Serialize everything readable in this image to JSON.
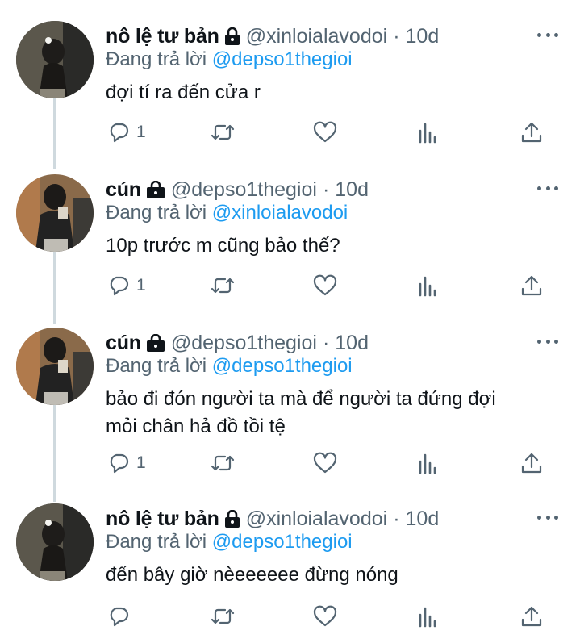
{
  "tweets": [
    {
      "author_name": "nô lệ tư bản",
      "handle": "@xinloialavodoi",
      "separator": "·",
      "time": "10d",
      "replying_prefix": "Đang trả lời",
      "replying_to": "@depso1thegioi",
      "text": "đợi tí ra đến cửa r",
      "reply_count": "1",
      "icons": [
        "lock-icon",
        "more-icon",
        "reply-icon",
        "retweet-icon",
        "like-icon",
        "analytics-icon",
        "share-icon"
      ]
    },
    {
      "author_name": "cún",
      "handle": "@depso1thegioi",
      "separator": "·",
      "time": "10d",
      "replying_prefix": "Đang trả lời",
      "replying_to": "@xinloialavodoi",
      "text": "10p trước m cũng bảo thế?",
      "reply_count": "1"
    },
    {
      "author_name": "cún",
      "handle": "@depso1thegioi",
      "separator": "·",
      "time": "10d",
      "replying_prefix": "Đang trả lời",
      "replying_to": "@depso1thegioi",
      "text": "bảo đi đón người ta mà để người ta đứng đợi\nmỏi chân hả đồ tồi tệ",
      "reply_count": "1"
    },
    {
      "author_name": "nô lệ tư bản",
      "handle": "@xinloialavodoi",
      "separator": "·",
      "time": "10d",
      "replying_prefix": "Đang trả lời",
      "replying_to": "@depso1thegioi",
      "text": "đến bây giờ nèeeeeee đừng nóng",
      "reply_count": ""
    }
  ],
  "colors": {
    "accent": "#1d9bf0",
    "secondary_text": "#536471",
    "thread_line": "#cfd9de"
  }
}
